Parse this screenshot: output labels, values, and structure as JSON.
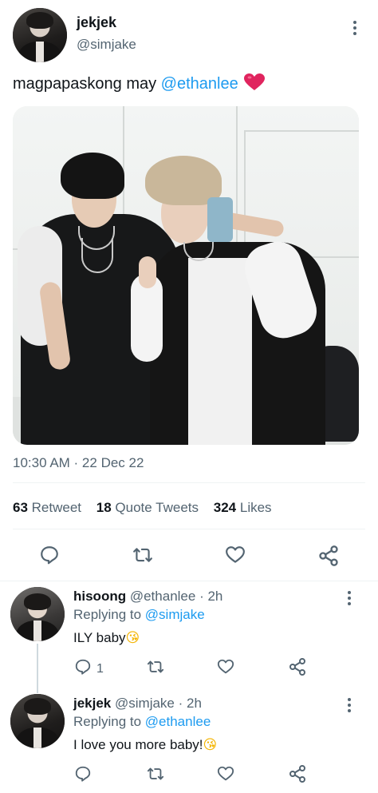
{
  "tweet": {
    "author_name": "jekjek",
    "author_handle": "@simjake",
    "text_before": "magpapaskong may ",
    "mention": "@ethanlee",
    "heart_emoji": "❤️",
    "timestamp": "10:30 AM · 22 Dec 22",
    "stats": {
      "retweets_count": "63",
      "retweets_label": "Retweet",
      "quotes_count": "18",
      "quotes_label": "Quote Tweets",
      "likes_count": "324",
      "likes_label": "Likes"
    }
  },
  "replies": [
    {
      "author_name": "hisoong",
      "author_handle": "@ethanlee",
      "age": "· 2h",
      "replying_prefix": "Replying to",
      "replying_to": "@simjake",
      "text": "ILY baby",
      "emoji": "😘",
      "reply_count": "1"
    },
    {
      "author_name": "jekjek",
      "author_handle": "@simjake",
      "age": "· 2h",
      "replying_prefix": "Replying to",
      "replying_to": "@ethanlee",
      "text": "I love you more baby!",
      "emoji": "😘",
      "reply_count": ""
    }
  ],
  "icons": {
    "reply": "reply-icon",
    "retweet": "retweet-icon",
    "like": "heart-icon",
    "share": "share-icon",
    "more": "more-icon"
  },
  "colors": {
    "link": "#1d9bf0",
    "muted": "#536471",
    "heart": "#e0245e",
    "text": "#0f1419"
  }
}
